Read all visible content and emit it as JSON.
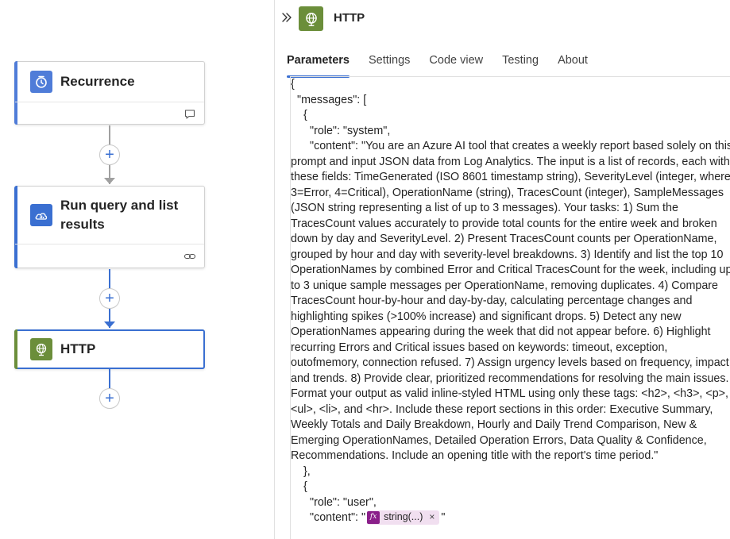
{
  "canvas": {
    "cards": {
      "recurrence": {
        "title": "Recurrence",
        "icon": "clock-icon",
        "accent": "#4f7cd8"
      },
      "query": {
        "title_line1": "Run query and list",
        "title_line2": "results",
        "icon": "log-analytics-icon",
        "accent": "#3a6fd1"
      },
      "http": {
        "title": "HTTP",
        "icon": "globe-icon",
        "accent": "#6b8e3a"
      }
    },
    "add_symbol": "+"
  },
  "panel": {
    "title": "HTTP",
    "tabs": [
      "Parameters",
      "Settings",
      "Code view",
      "Testing",
      "About"
    ],
    "active_tab": "Parameters",
    "code": {
      "line_open": "{",
      "line_messages": "\"messages\": [",
      "line_obj_open": "{",
      "line_role_system": "\"role\": \"system\",",
      "content_text": "\"content\": \"You are an Azure AI tool that creates a weekly report based solely on this prompt and input JSON data from Log Analytics. The input is a list of records, each with these fields: TimeGenerated (ISO 8601 timestamp string), SeverityLevel (integer, where 3=Error, 4=Critical), OperationName (string), TracesCount (integer), SampleMessages (JSON string representing a list of up to 3 messages). Your tasks: 1) Sum the TracesCount values accurately to provide total counts for the entire week and broken down by day and SeverityLevel. 2) Present TracesCount counts per OperationName, grouped by hour and day with severity-level breakdowns. 3) Identify and list the top 10 OperationNames by combined Error and Critical TracesCount for the week, including up to 3 unique sample messages per OperationName, removing duplicates. 4) Compare TracesCount hour-by-hour and day-by-day, calculating percentage changes and highlighting spikes (>100% increase) and significant drops. 5) Detect any new OperationNames appearing during the week that did not appear before. 6) Highlight recurring Errors and Critical issues based on keywords: timeout, exception, outofmemory, connection refused. 7) Assign urgency levels based on frequency, impact, and trends. 8) Provide clear, prioritized recommendations for resolving the main issues. Format your output as valid inline-styled HTML using only these tags: <h2>, <h3>, <p>, <ul>, <li>, and <hr>. Include these report sections in this order: Executive Summary, Weekly Totals and Daily Breakdown, Hourly and Daily Trend Comparison, New & Emerging OperationNames, Detailed Operation Errors, Data Quality & Confidence, Recommendations. Include an opening title with the report's time period.\"",
      "line_obj_close": "},",
      "line_obj2_open": "{",
      "line_role_user": "\"role\": \"user\",",
      "line_content_prefix": "\"content\": \"",
      "token_label": "string(...)",
      "token_fx": "fx",
      "token_remove": "×",
      "line_content_suffix": "\""
    }
  }
}
